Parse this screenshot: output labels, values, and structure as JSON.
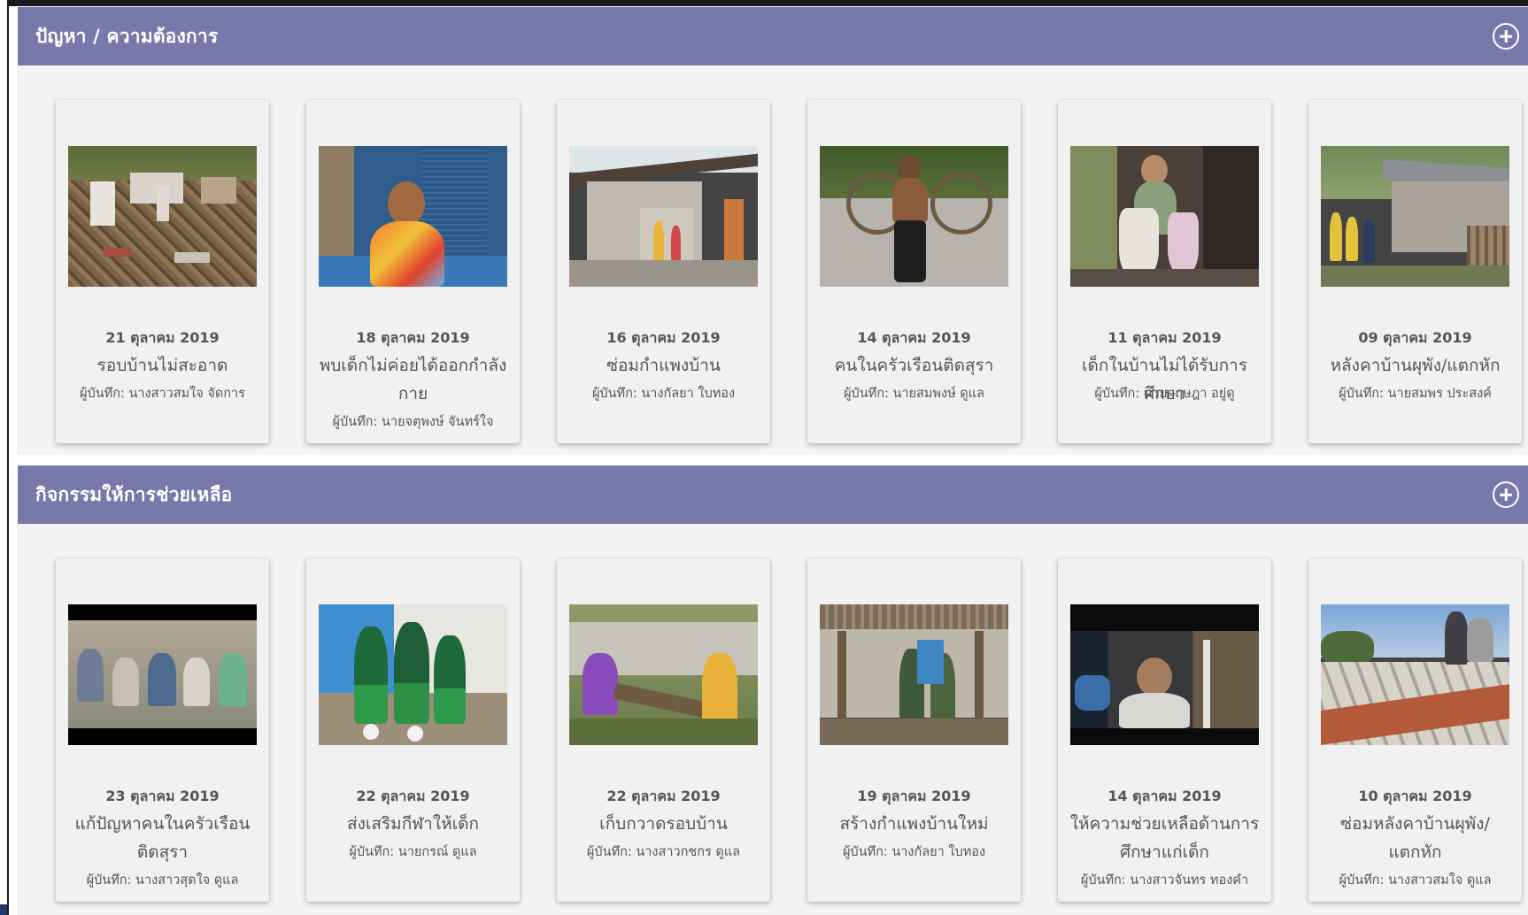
{
  "sections": [
    {
      "title": "ปัญหา / ความต้องการ",
      "add_icon": "plus-circle-icon",
      "cards": [
        {
          "date": "21 ตุลาคม 2019",
          "title": "รอบบ้านไม่สะอาด",
          "recorder": "ผู้บันทึก: นางสาวสมใจ จัดการ",
          "photo": "messy-yard-photo"
        },
        {
          "date": "18 ตุลาคม 2019",
          "title": "พบเด็กไม่ค่อยได้ออกกำลังกาย",
          "recorder": "ผู้บันทึก: นายจตุพงษ์ จันทร์ใจ",
          "photo": "child-sitting-photo"
        },
        {
          "date": "16 ตุลาคม 2019",
          "title": "ซ่อมกำแพงบ้าน",
          "recorder": "ผู้บันทึก: นางกัลยา ใบทอง",
          "photo": "broken-house-photo"
        },
        {
          "date": "14 ตุลาคม 2019",
          "title": "คนในครัวเรือนติดสุรา",
          "recorder": "ผู้บันทึก: นายสมพงษ์ ดูแล",
          "photo": "man-with-bicycle-photo"
        },
        {
          "date": "11 ตุลาคม 2019",
          "title": "เด็กในบ้านไม่ได้รับการศึกษา",
          "recorder": "ผู้บันทึก: นายกฤษฎา อยู่ดู",
          "photo": "child-with-bags-photo"
        },
        {
          "date": "09 ตุลาคม 2019",
          "title": "หลังคาบ้านผุพัง/แตกหัก",
          "recorder": "ผู้บันทึก: นายสมพร ประสงค์",
          "photo": "damaged-roof-house-photo"
        }
      ]
    },
    {
      "title": "กิจกรรมให้การช่วยเหลือ",
      "add_icon": "plus-circle-icon",
      "cards": [
        {
          "date": "23 ตุลาคม 2019",
          "title": "แก้ปัญหาคนในครัวเรือนติดสุรา",
          "recorder": "ผู้บันทึก: นางสาวสุดใจ ดูแล",
          "photo": "meeting-crowd-photo"
        },
        {
          "date": "22 ตุลาคม 2019",
          "title": "ส่งเสริมกีฬาให้เด็ก",
          "recorder": "ผู้บันทึก: นายกรณ์ ดูแล",
          "photo": "kids-football-photo"
        },
        {
          "date": "22 ตุลาคม 2019",
          "title": "เก็บกวาดรอบบ้าน",
          "recorder": "ผู้บันทึก: นางสาวกชกร ดูแล",
          "photo": "yard-cleanup-photo"
        },
        {
          "date": "19 ตุลาคม 2019",
          "title": "สร้างกำแพงบ้านใหม่",
          "recorder": "ผู้บันทึก: นางกัลยา ใบทอง",
          "photo": "building-wall-photo"
        },
        {
          "date": "14 ตุลาคม 2019",
          "title": "ให้ความช่วยเหลือด้านการศึกษาแก่เด็ก",
          "recorder": "ผู้บันทึก: นางสาวจันทร ทองคำ",
          "photo": "child-studying-photo"
        },
        {
          "date": "10 ตุลาคม 2019",
          "title": "ซ่อมหลังคาบ้านผุพัง/แตกหัก",
          "recorder": "ผู้บันทึก: นางสาวสมใจ ดูแล",
          "photo": "roof-repair-photo"
        }
      ]
    }
  ]
}
